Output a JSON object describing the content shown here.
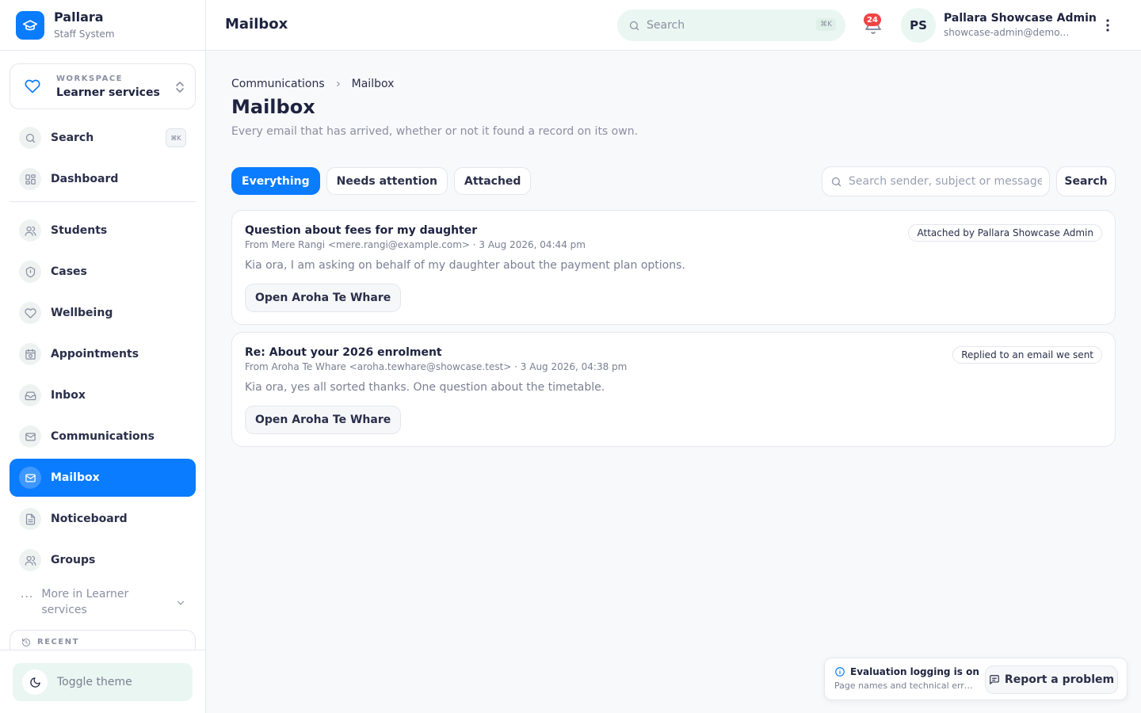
{
  "brand": {
    "name": "Pallara",
    "subtitle": "Staff System"
  },
  "workspace": {
    "label": "WORKSPACE",
    "value": "Learner services"
  },
  "sidebar": {
    "search": {
      "label": "Search",
      "shortcut": "⌘K"
    },
    "items": [
      {
        "label": "Dashboard",
        "icon": "grid-icon"
      },
      {
        "label": "Students",
        "icon": "users-icon"
      },
      {
        "label": "Cases",
        "icon": "shield-icon"
      },
      {
        "label": "Wellbeing",
        "icon": "heart-icon"
      },
      {
        "label": "Appointments",
        "icon": "calendar-clock-icon"
      },
      {
        "label": "Inbox",
        "icon": "inbox-icon"
      },
      {
        "label": "Communications",
        "icon": "mail-icon"
      },
      {
        "label": "Mailbox",
        "icon": "mail-icon",
        "active": true
      },
      {
        "label": "Noticeboard",
        "icon": "document-icon"
      },
      {
        "label": "Groups",
        "icon": "users-icon"
      }
    ],
    "more": "More in Learner services",
    "recent": "RECENT",
    "toggle_theme": "Toggle theme"
  },
  "topbar": {
    "title": "Mailbox",
    "search_placeholder": "Search",
    "search_shortcut": "⌘K",
    "notification_count": "24",
    "user": {
      "initials": "PS",
      "name": "Pallara Showcase Admin",
      "email": "showcase-admin@demo.pallara.test"
    }
  },
  "page": {
    "breadcrumb": [
      "Communications",
      "Mailbox"
    ],
    "title": "Mailbox",
    "subtitle": "Every email that has arrived, whether or not it found a record on its own."
  },
  "tabs": [
    "Everything",
    "Needs attention",
    "Attached"
  ],
  "filter": {
    "placeholder": "Search sender, subject or message",
    "button": "Search"
  },
  "emails": [
    {
      "subject": "Question about fees for my daughter",
      "meta": "From Mere Rangi <mere.rangi@example.com> · 3 Aug 2026, 04:44 pm",
      "snippet": "Kia ora, I am asking on behalf of my daughter about the payment plan options.",
      "status": "Attached by Pallara Showcase Admin",
      "action": "Open Aroha Te Whare"
    },
    {
      "subject": "Re: About your 2026 enrolment",
      "meta": "From Aroha Te Whare <aroha.tewhare@showcase.test> · 3 Aug 2026, 04:38 pm",
      "snippet": "Kia ora, yes all sorted thanks. One question about the timetable.",
      "status": "Replied to an email we sent",
      "action": "Open Aroha Te Whare"
    }
  ],
  "evaluation": {
    "title": "Evaluation logging is on",
    "subtitle": "Page names and technical errors are recorded",
    "button": "Report a problem"
  },
  "colors": {
    "accent": "#0a7cff",
    "mint": "#eaf6f1",
    "badge": "#ef4444"
  }
}
